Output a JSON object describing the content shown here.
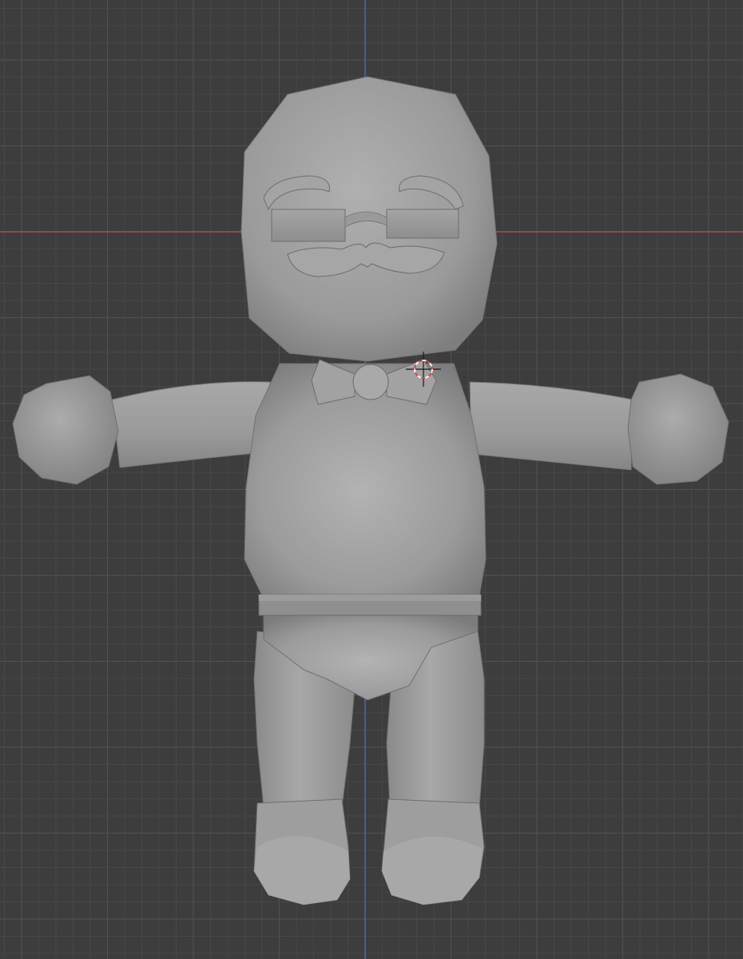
{
  "viewport": {
    "view": "front-orthographic",
    "colors": {
      "background": "#3d3d3d",
      "grid_minor": "#474747",
      "grid_major": "#525252",
      "axis_x": "#b8474f",
      "axis_z": "#3f6fae",
      "mesh_light": "#a9a9a9",
      "mesh_mid": "#959595",
      "mesh_dark": "#7a7a7a",
      "cursor_red": "#e04040",
      "cursor_white": "#f2f2f2"
    }
  },
  "scene": {
    "object": "character-mesh",
    "parts": [
      "head",
      "eyebrows",
      "glasses",
      "mustache",
      "bow-tie",
      "torso",
      "belt",
      "arms",
      "hands",
      "pelvis",
      "legs",
      "boots"
    ]
  },
  "cursor_3d": {
    "icon": "3d-cursor-icon"
  }
}
